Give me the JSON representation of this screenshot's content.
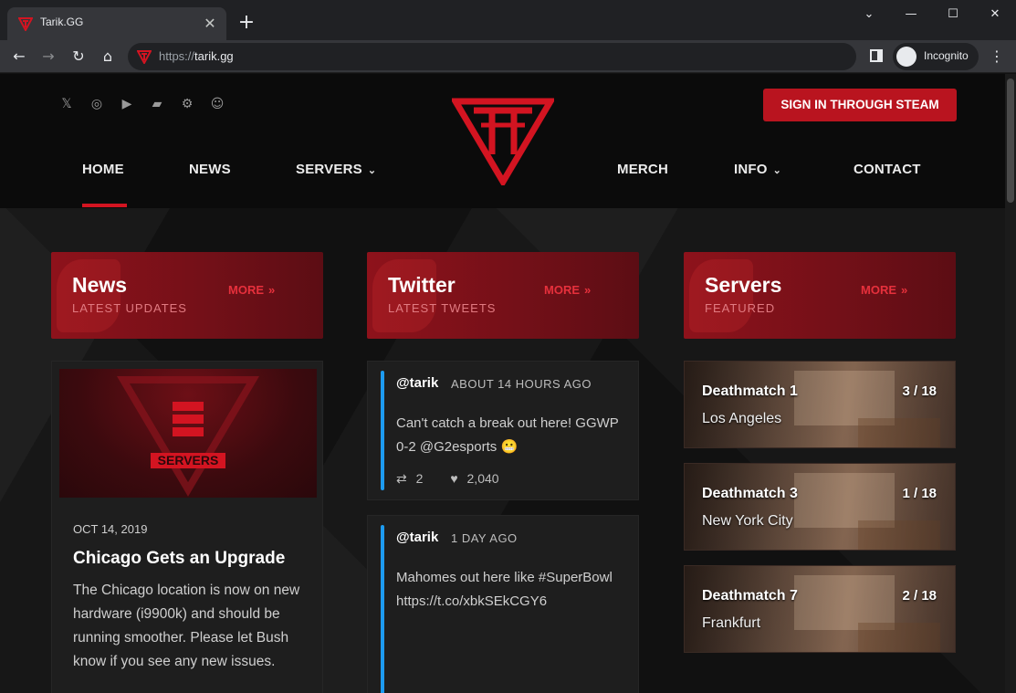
{
  "browser": {
    "tab_title": "Tarik.GG",
    "tab_close": "✕",
    "new_tab": "+",
    "url_protocol": "https://",
    "url_host": "tarik.gg",
    "incognito_label": "Incognito",
    "window_controls": {
      "minimize": "—",
      "maximize": "☐",
      "close": "✕",
      "dropdown": "⌄"
    },
    "nav": {
      "back": "←",
      "forward": "→",
      "reload": "↻",
      "home": "⌂",
      "menu": "⋮"
    }
  },
  "header": {
    "socials": [
      "twitter-icon",
      "instagram-icon",
      "youtube-icon",
      "twitch-icon",
      "steam-icon",
      "discord-icon"
    ],
    "social_glyphs": [
      "𝕏",
      "◎",
      "▶",
      "▰",
      "⚙",
      "☺"
    ],
    "steam_button": "SIGN IN THROUGH STEAM",
    "nav": {
      "home": "HOME",
      "news": "NEWS",
      "servers": "SERVERS",
      "merch": "MERCH",
      "info": "INFO",
      "contact": "CONTACT",
      "chevron": "⌄"
    },
    "brand_color": "#d31421"
  },
  "sections": {
    "news": {
      "title": "News",
      "subtitle": "LATEST UPDATES",
      "more": "MORE"
    },
    "twitter": {
      "title": "Twitter",
      "subtitle": "LATEST TWEETS",
      "more": "MORE"
    },
    "servers": {
      "title": "Servers",
      "subtitle": "FEATURED",
      "more": "MORE"
    },
    "more_arrow": "»"
  },
  "news_post": {
    "image_label": "SERVERS",
    "date": "OCT 14, 2019",
    "title": "Chicago Gets an Upgrade",
    "body": "The Chicago location is now on new hardware (i9900k) and should be running smoother. Please let Bush know if you see any new issues."
  },
  "tweets": [
    {
      "user": "@tarik",
      "time": "ABOUT 14 HOURS AGO",
      "text": "Can't catch a break out here! GGWP 0-2 @G2esports 😬",
      "retweets": "2",
      "likes": "2,040"
    },
    {
      "user": "@tarik",
      "time": "1 DAY AGO",
      "text": "Mahomes out here like #SuperBowl https://t.co/xbkSEkCGY6"
    }
  ],
  "tweet_icons": {
    "retweet": "⇄",
    "like": "♥"
  },
  "servers": [
    {
      "name": "Deathmatch 1",
      "location": "Los Angeles",
      "players": "3 / 18"
    },
    {
      "name": "Deathmatch 3",
      "location": "New York City",
      "players": "1 / 18"
    },
    {
      "name": "Deathmatch 7",
      "location": "Frankfurt",
      "players": "2 / 18"
    }
  ]
}
